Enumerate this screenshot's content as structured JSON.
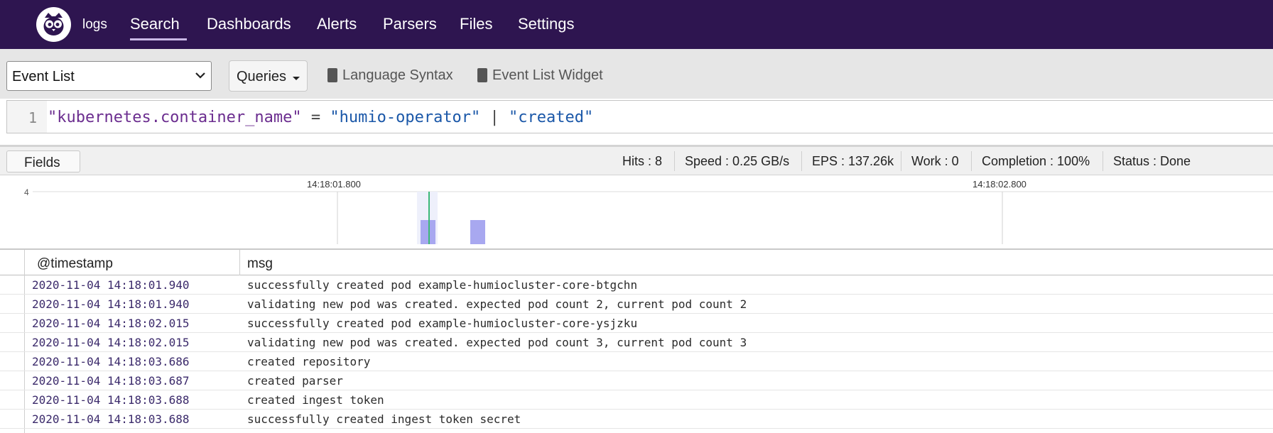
{
  "nav": {
    "repo": "logs",
    "items": [
      "Search",
      "Dashboards",
      "Alerts",
      "Parsers",
      "Files",
      "Settings"
    ],
    "active": "Search"
  },
  "toolbar": {
    "widget_select": "Event List",
    "queries_label": "Queries",
    "links": [
      "Language Syntax",
      "Event List Widget"
    ]
  },
  "query": {
    "line_number": "1",
    "field": "\"kubernetes.container_name\"",
    "op1": " = ",
    "value": "\"humio-operator\"",
    "op2": " | ",
    "filter": "\"created\""
  },
  "status": {
    "fields_label": "Fields",
    "hits": "Hits : 8",
    "speed": "Speed : 0.25 GB/s",
    "eps": "EPS : 137.26k",
    "work": "Work : 0",
    "completion": "Completion : 100%",
    "state": "Status : Done"
  },
  "histogram": {
    "y_max_label": "4",
    "ticks": [
      "14:18:01.800",
      "14:18:02.800"
    ],
    "bar_color": "#a8a8f0",
    "marker_color": "#3cb878"
  },
  "table": {
    "columns": [
      "@timestamp",
      "msg"
    ],
    "rows": [
      {
        "timestamp": "2020-11-04 14:18:01.940",
        "msg": "successfully created pod example-humiocluster-core-btgchn"
      },
      {
        "timestamp": "2020-11-04 14:18:01.940",
        "msg": "validating new pod was created. expected pod count 2, current pod count 2"
      },
      {
        "timestamp": "2020-11-04 14:18:02.015",
        "msg": "successfully created pod example-humiocluster-core-ysjzku"
      },
      {
        "timestamp": "2020-11-04 14:18:02.015",
        "msg": "validating new pod was created. expected pod count 3, current pod count 3"
      },
      {
        "timestamp": "2020-11-04 14:18:03.686",
        "msg": "created repository"
      },
      {
        "timestamp": "2020-11-04 14:18:03.687",
        "msg": "created parser"
      },
      {
        "timestamp": "2020-11-04 14:18:03.688",
        "msg": "created ingest token"
      },
      {
        "timestamp": "2020-11-04 14:18:03.688",
        "msg": "successfully created ingest token secret"
      }
    ]
  }
}
